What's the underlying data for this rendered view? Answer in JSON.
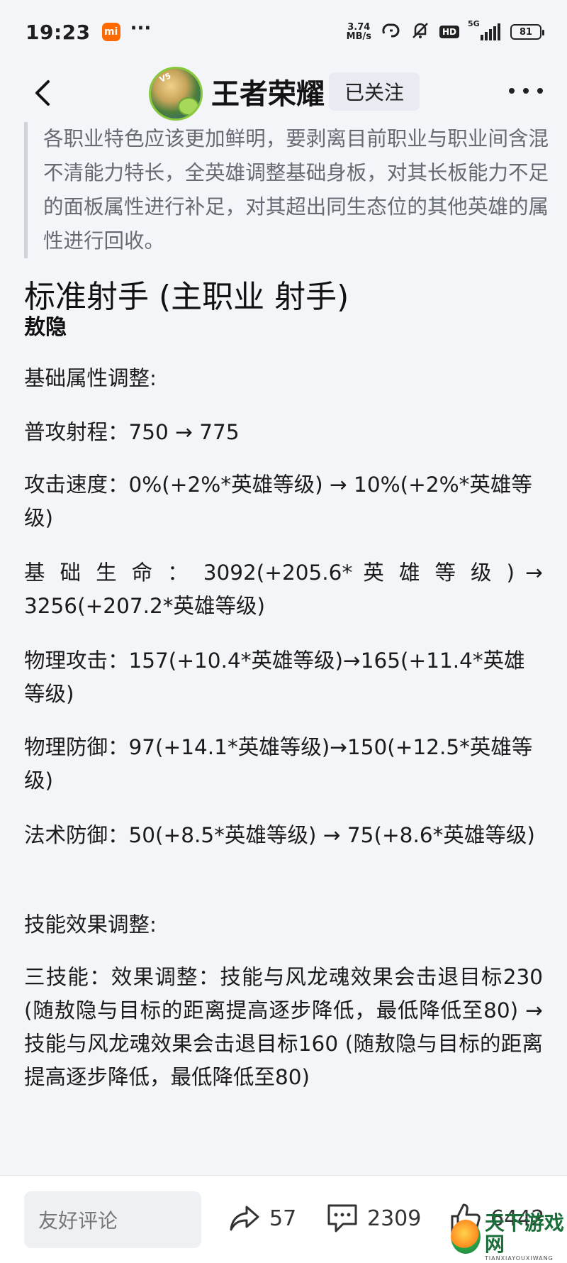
{
  "status_bar": {
    "time": "19:23",
    "brand_badge": "mi",
    "dots": "···",
    "net_speed_value": "3.74",
    "net_speed_unit": "MB/s",
    "hd": "HD",
    "network": "5G",
    "battery": "81"
  },
  "header": {
    "account_name": "王者荣耀",
    "follow_label": "已关注",
    "avatar_badge": "V5"
  },
  "content": {
    "quote": "各职业特色应该更加鲜明，要剥离目前职业与职业间含混不清能力特长，全英雄调整基础身板，对其长板能力不足的面板属性进行补足，对其超出同生态位的其他英雄的属性进行回收。",
    "title": "标准射手 (主职业 射手)",
    "hero": "敖隐",
    "base_heading": "基础属性调整:",
    "range": "普攻射程：750 → 775",
    "attack_speed": "攻击速度：0%(+2%*英雄等级) → 10%(+2%*英雄等级)",
    "hp": "基 础 生 命 ： 3092(+205.6* 英 雄 等 级 ) → 3256(+207.2*英雄等级)",
    "phys_attack": "物理攻击：157(+10.4*英雄等级)→165(+11.4*英雄等级)",
    "phys_def": "物理防御：97(+14.1*英雄等级)→150(+12.5*英雄等级)",
    "magic_def": "法术防御：50(+8.5*英雄等级) → 75(+8.6*英雄等级)",
    "skill_heading": "技能效果调整:",
    "skill3": "三技能：效果调整：技能与风龙魂效果会击退目标230 (随敖隐与目标的距离提高逐步降低，最低降低至80) → 技能与风龙魂效果会击退目标160 (随敖隐与目标的距离提高逐步降低，最低降低至80)"
  },
  "bottom_bar": {
    "comment_placeholder": "友好评论",
    "shares": "57",
    "comments": "2309",
    "likes": "6442"
  },
  "watermark": {
    "title": "天下游戏网",
    "subtitle": "TIANXIAYOUXIWANG"
  }
}
